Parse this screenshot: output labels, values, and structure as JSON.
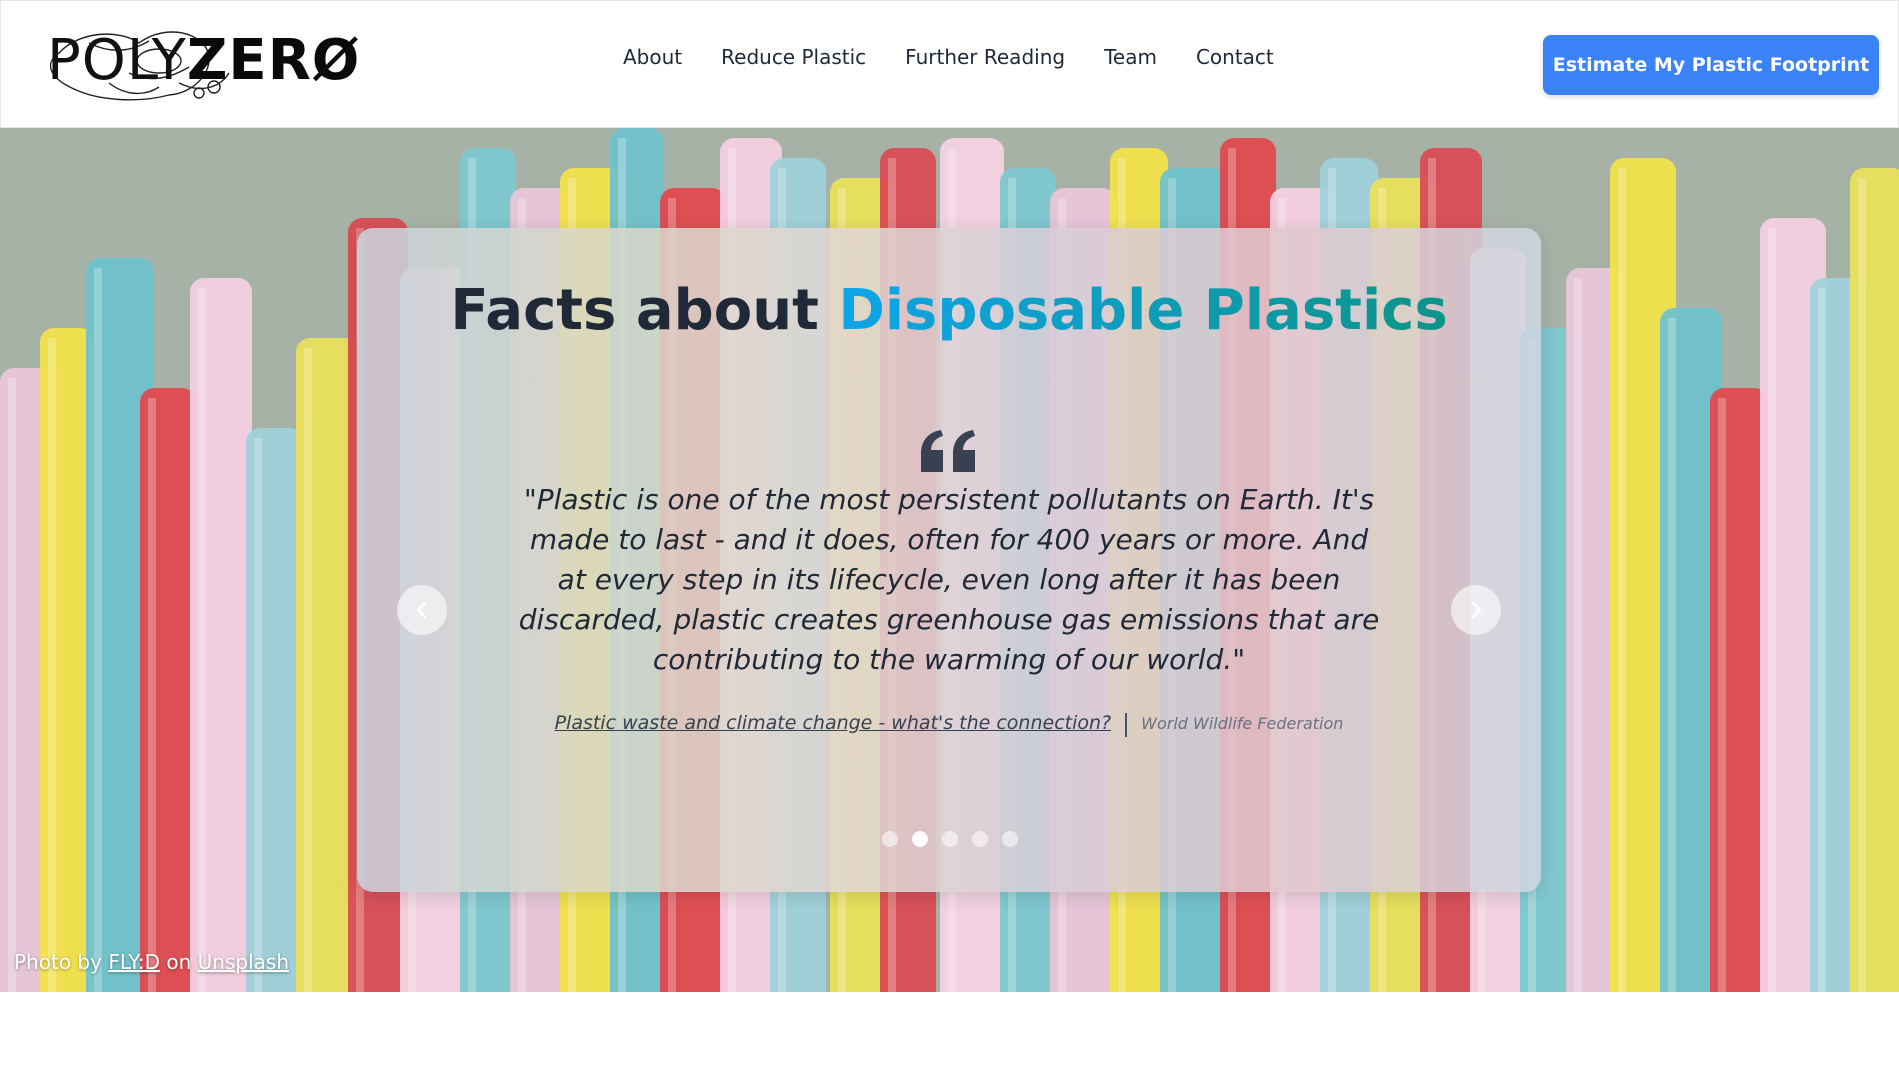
{
  "header": {
    "logo": {
      "text_poly": "POLY",
      "text_zero": "ZERØ"
    },
    "nav": [
      {
        "label": "About"
      },
      {
        "label": "Reduce Plastic"
      },
      {
        "label": "Further Reading"
      },
      {
        "label": "Team"
      },
      {
        "label": "Contact"
      }
    ],
    "cta_label": "Estimate My Plastic Footprint",
    "accent_color": "#3b82f6"
  },
  "hero": {
    "title_prefix": "Facts about",
    "title_highlight": "Disposable Plastics",
    "quote": "\"Plastic is one of the most persistent pollutants on Earth. It's made to last - and it does, often for 400 years or more. And at every step in its lifecycle, even long after it has been discarded, plastic creates greenhouse gas emissions that are contributing to the warming of our world.\"",
    "source_link": "Plastic waste and climate change - what's the connection?",
    "source_org": "World Wildlife Federation",
    "carousel": {
      "slide_count": 5,
      "active_index": 1
    },
    "icons": {
      "quote": "quote-icon",
      "prev": "chevron-left-icon",
      "next": "chevron-right-icon"
    },
    "credit": {
      "prefix": "Photo by",
      "author": "FLY:D",
      "middle": "on",
      "site": "Unsplash"
    }
  }
}
